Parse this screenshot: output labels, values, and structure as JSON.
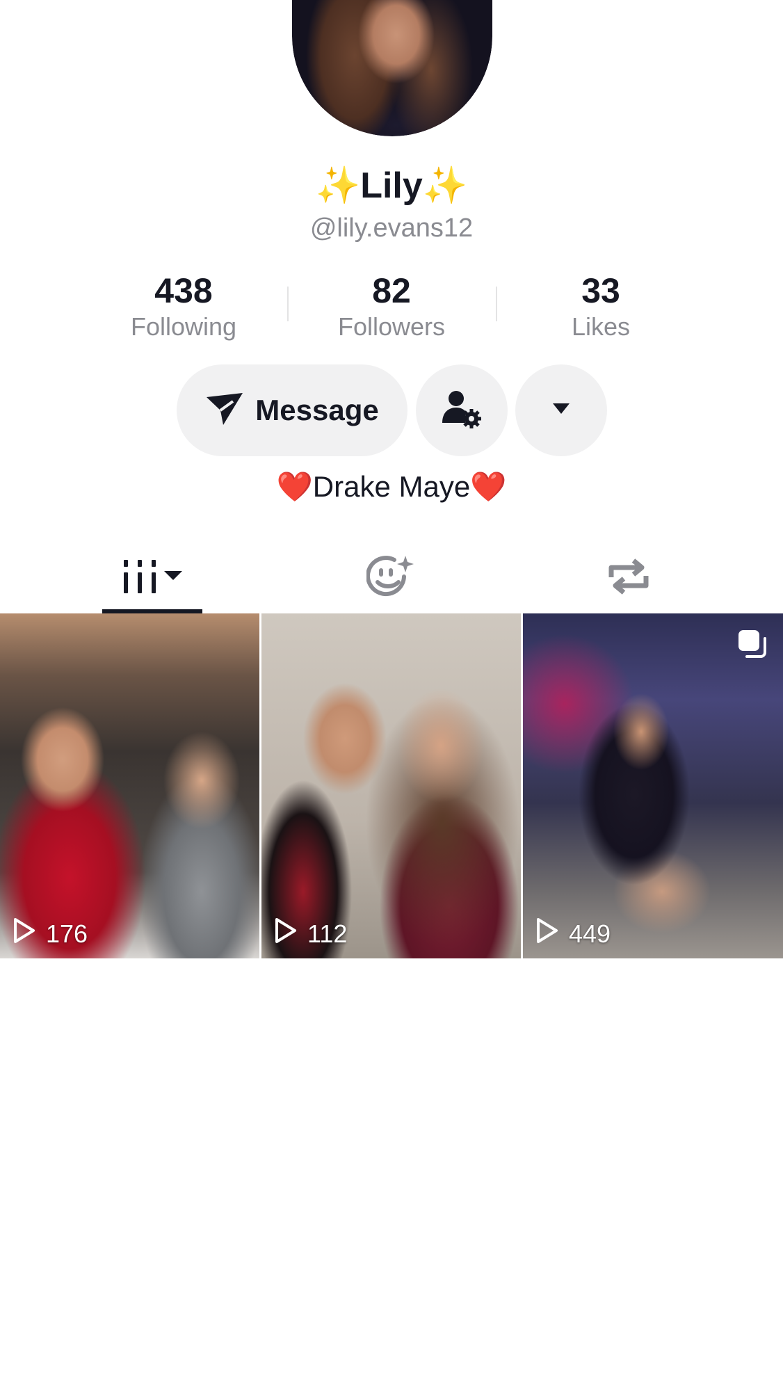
{
  "profile": {
    "display_name_prefix": "✨",
    "display_name": "Lily",
    "display_name_suffix": "✨",
    "handle": "@lily.evans12",
    "bio": "❤️Drake Maye❤️"
  },
  "stats": [
    {
      "value": "438",
      "label": "Following"
    },
    {
      "value": "82",
      "label": "Followers"
    },
    {
      "value": "33",
      "label": "Likes"
    }
  ],
  "actions": {
    "message_label": "Message",
    "add_friend_icon": "user-gear-icon",
    "more_icon": "caret-down-icon"
  },
  "tabs": [
    {
      "icon": "grid-icon",
      "active": true
    },
    {
      "icon": "sparkle-face-icon",
      "active": false
    },
    {
      "icon": "repost-icon",
      "active": false
    }
  ],
  "videos": [
    {
      "views": "176"
    },
    {
      "views": "112"
    },
    {
      "views": "449",
      "badge": "multi-photo-icon"
    }
  ],
  "colors": {
    "text": "#161823",
    "secondary": "#8a8b91",
    "button_bg": "#f1f1f2",
    "sparkle": "#f4c20d"
  }
}
